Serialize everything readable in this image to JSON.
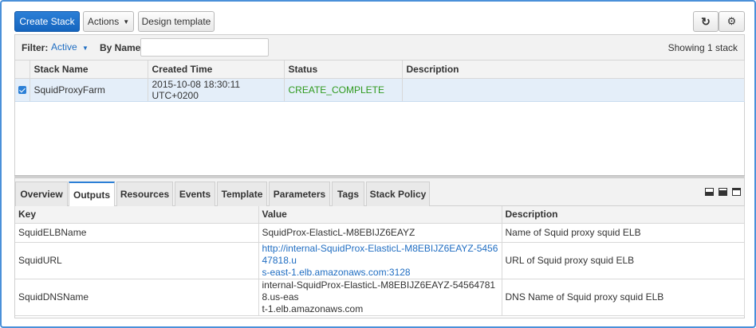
{
  "toolbar": {
    "create_stack": "Create Stack",
    "actions": "Actions",
    "design_template": "Design template",
    "refresh_icon": "↻",
    "settings_icon": "⚙"
  },
  "filter": {
    "label": "Filter:",
    "active": "Active",
    "by_name_label": "By Name:",
    "by_name_value": "",
    "showing": "Showing 1 stack"
  },
  "stacks": {
    "columns": [
      "Stack Name",
      "Created Time",
      "Status",
      "Description"
    ],
    "rows": [
      {
        "selected": true,
        "name": "SquidProxyFarm",
        "created": "2015-10-08 18:30:11 UTC+0200",
        "status": "CREATE_COMPLETE",
        "description": ""
      }
    ]
  },
  "tabs": [
    "Overview",
    "Outputs",
    "Resources",
    "Events",
    "Template",
    "Parameters",
    "Tags",
    "Stack Policy"
  ],
  "active_tab": "Outputs",
  "outputs": {
    "columns": [
      "Key",
      "Value",
      "Description"
    ],
    "rows": [
      {
        "key": "SquidELBName",
        "value_line1": "SquidProx-ElasticL-M8EBIJZ6EAYZ",
        "value_line2": "",
        "description": "Name of Squid proxy squid ELB"
      },
      {
        "key": "SquidURL",
        "value_line1": "http://internal-SquidProx-ElasticL-M8EBIJZ6EAYZ-545647818.u",
        "value_line2": "s-east-1.elb.amazonaws.com:3128",
        "description": "URL of Squid proxy squid ELB"
      },
      {
        "key": "SquidDNSName",
        "value_line1": "internal-SquidProx-ElasticL-M8EBIJZ6EAYZ-545647818.us-eas",
        "value_line2": "t-1.elb.amazonaws.com",
        "description": "DNS Name of Squid proxy squid ELB"
      }
    ]
  },
  "colors": {
    "primary": "#1f6dc2",
    "status_ok": "#2f9a1e",
    "selected_row": "#e4eef9"
  }
}
